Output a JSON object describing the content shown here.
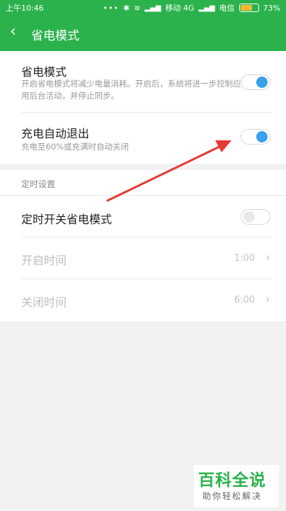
{
  "status_bar": {
    "time": "上午10:46",
    "dots": "•••",
    "carrier1": "移动 4G",
    "carrier2": "电信",
    "battery": "73%",
    "battery_level": 0.73
  },
  "header": {
    "back_icon": "chevron-left-icon",
    "title": "省电模式"
  },
  "settings": {
    "power_saving": {
      "label": "省电模式",
      "description": "开启省电模式将减少电量消耗。开启后，系统将进一步控制应用后台活动，并停止同步。",
      "enabled": true
    },
    "auto_exit": {
      "label": "充电自动退出",
      "description": "充电至60%或充满时自动关闭",
      "enabled": true
    }
  },
  "schedule": {
    "section_label": "定时设置",
    "scheduled_toggle": {
      "label": "定时开关省电模式",
      "enabled": false
    },
    "start_time": {
      "label": "开启时间",
      "value": "1:00"
    },
    "end_time": {
      "label": "关闭时间",
      "value": "6:00"
    }
  },
  "watermark": {
    "main": "百科全说",
    "sub": "助你轻松解决"
  },
  "colors": {
    "accent": "#2bb24c",
    "toggle_on": "#3aa0ea",
    "arrow": "#e23b34"
  }
}
